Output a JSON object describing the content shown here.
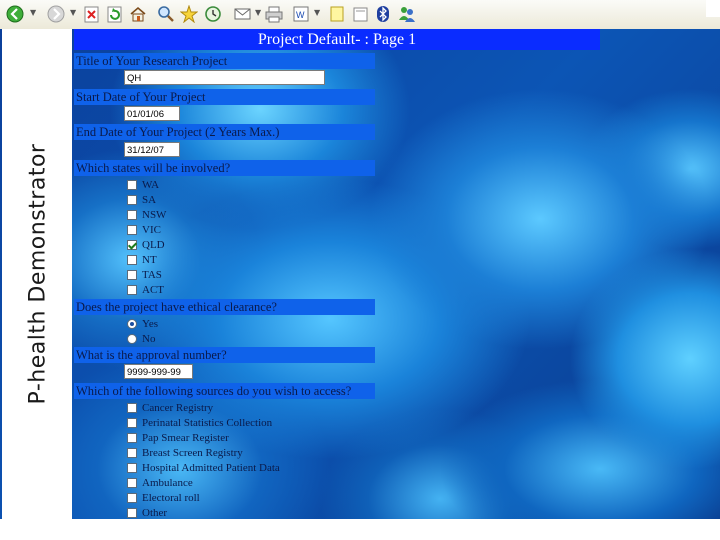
{
  "toolbar": {
    "icons": [
      "back-icon",
      "forward-icon",
      "stop-icon",
      "refresh-icon",
      "home-icon",
      "search-icon",
      "favorites-icon",
      "history-icon",
      "mail-icon",
      "print-icon",
      "edit-word-icon",
      "notes-icon",
      "bluetooth-icon",
      "messenger-icon"
    ]
  },
  "sidebar": {
    "title": "P-health Demonstrator"
  },
  "form": {
    "header": "Project Default- : Page 1",
    "title_question": "Title of Your Research Project",
    "title_value": "QH",
    "start_question": "Start Date of Your Project",
    "start_value": "01/01/06",
    "end_question": "End Date of Your Project (2 Years Max.)",
    "end_value": "31/12/07",
    "states_question": "Which states will be involved?",
    "states": [
      {
        "label": "WA",
        "checked": false
      },
      {
        "label": "SA",
        "checked": false
      },
      {
        "label": "NSW",
        "checked": false
      },
      {
        "label": "VIC",
        "checked": false
      },
      {
        "label": "QLD",
        "checked": true
      },
      {
        "label": "NT",
        "checked": false
      },
      {
        "label": "TAS",
        "checked": false
      },
      {
        "label": "ACT",
        "checked": false
      }
    ],
    "ethics_question": "Does the project have ethical clearance?",
    "ethics_options": [
      {
        "label": "Yes",
        "checked": true
      },
      {
        "label": "No",
        "checked": false
      }
    ],
    "approval_question": "What is the approval number?",
    "approval_value": "9999-999-99",
    "sources_question": "Which of the following sources do you wish to access?",
    "sources": [
      {
        "label": "Cancer Registry",
        "checked": false
      },
      {
        "label": "Perinatal Statistics Collection",
        "checked": false
      },
      {
        "label": "Pap Smear Register",
        "checked": false
      },
      {
        "label": "Breast Screen Registry",
        "checked": false
      },
      {
        "label": "Hospital Admitted Patient Data",
        "checked": false
      },
      {
        "label": "Ambulance",
        "checked": false
      },
      {
        "label": "Electoral roll",
        "checked": false
      },
      {
        "label": "Other",
        "checked": false
      }
    ]
  }
}
